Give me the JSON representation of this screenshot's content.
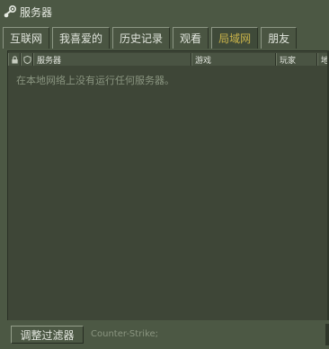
{
  "window": {
    "title": "服务器"
  },
  "tabs": [
    {
      "label": "互联网"
    },
    {
      "label": "我喜爱的"
    },
    {
      "label": "历史记录"
    },
    {
      "label": "观看"
    },
    {
      "label": "局域网",
      "active": true
    },
    {
      "label": "朋友"
    }
  ],
  "list": {
    "columns": {
      "lock": "lock-icon",
      "shield": "shield-icon",
      "servers": "服务器",
      "game": "游戏",
      "players": "玩家",
      "map": "地"
    },
    "empty_message": "在本地网络上没有运行任何服务器。"
  },
  "bottom": {
    "filter_button": "调整过滤器",
    "filter_status": "Counter-Strike;"
  },
  "colors": {
    "background": "#4c5844",
    "active_tab_text": "#c9b34a",
    "muted_text": "#8a9580"
  }
}
